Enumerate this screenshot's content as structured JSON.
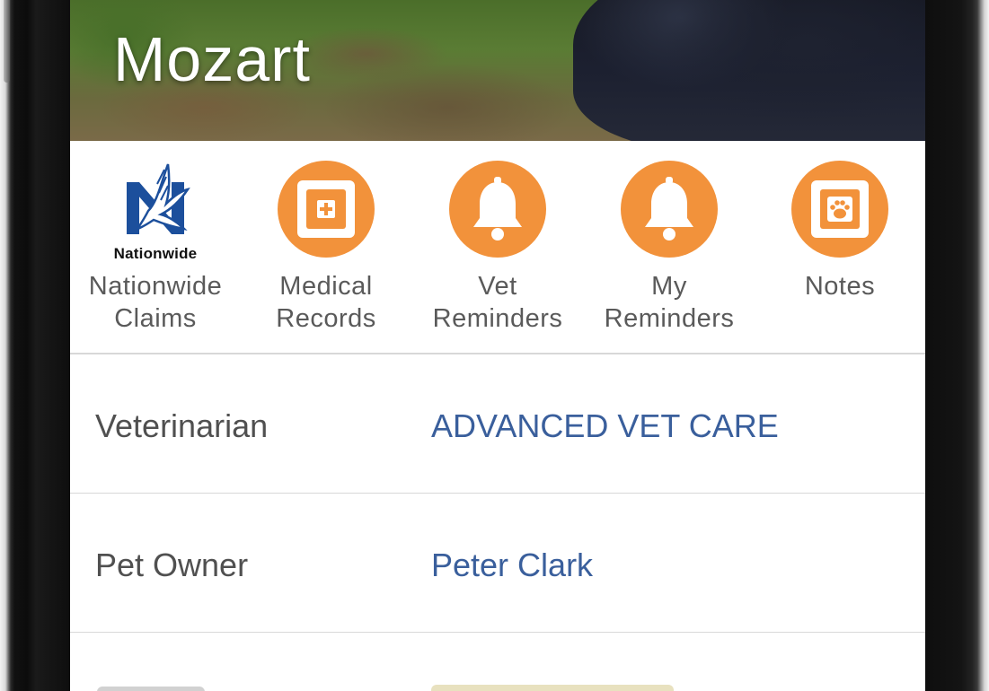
{
  "pet": {
    "name": "Mozart"
  },
  "actions": [
    {
      "label_line1": "Nationwide",
      "label_line2": "Claims",
      "icon": "nationwide-logo",
      "logo_text": "Nationwide"
    },
    {
      "label_line1": "Medical",
      "label_line2": "Records",
      "icon": "medical-plus-icon"
    },
    {
      "label_line1": "Vet",
      "label_line2": "Reminders",
      "icon": "bell-icon"
    },
    {
      "label_line1": "My",
      "label_line2": "Reminders",
      "icon": "bell-icon"
    },
    {
      "label_line1": "Notes",
      "label_line2": "",
      "icon": "paw-notes-icon"
    }
  ],
  "details": [
    {
      "key": "Veterinarian",
      "value": "ADVANCED VET CARE"
    },
    {
      "key": "Pet Owner",
      "value": "Peter Clark"
    }
  ],
  "colors": {
    "accent_orange": "#f2923b",
    "link_blue": "#3a5f9c",
    "nationwide_blue": "#1c4f9c",
    "label_gray": "#5a5a5a"
  }
}
